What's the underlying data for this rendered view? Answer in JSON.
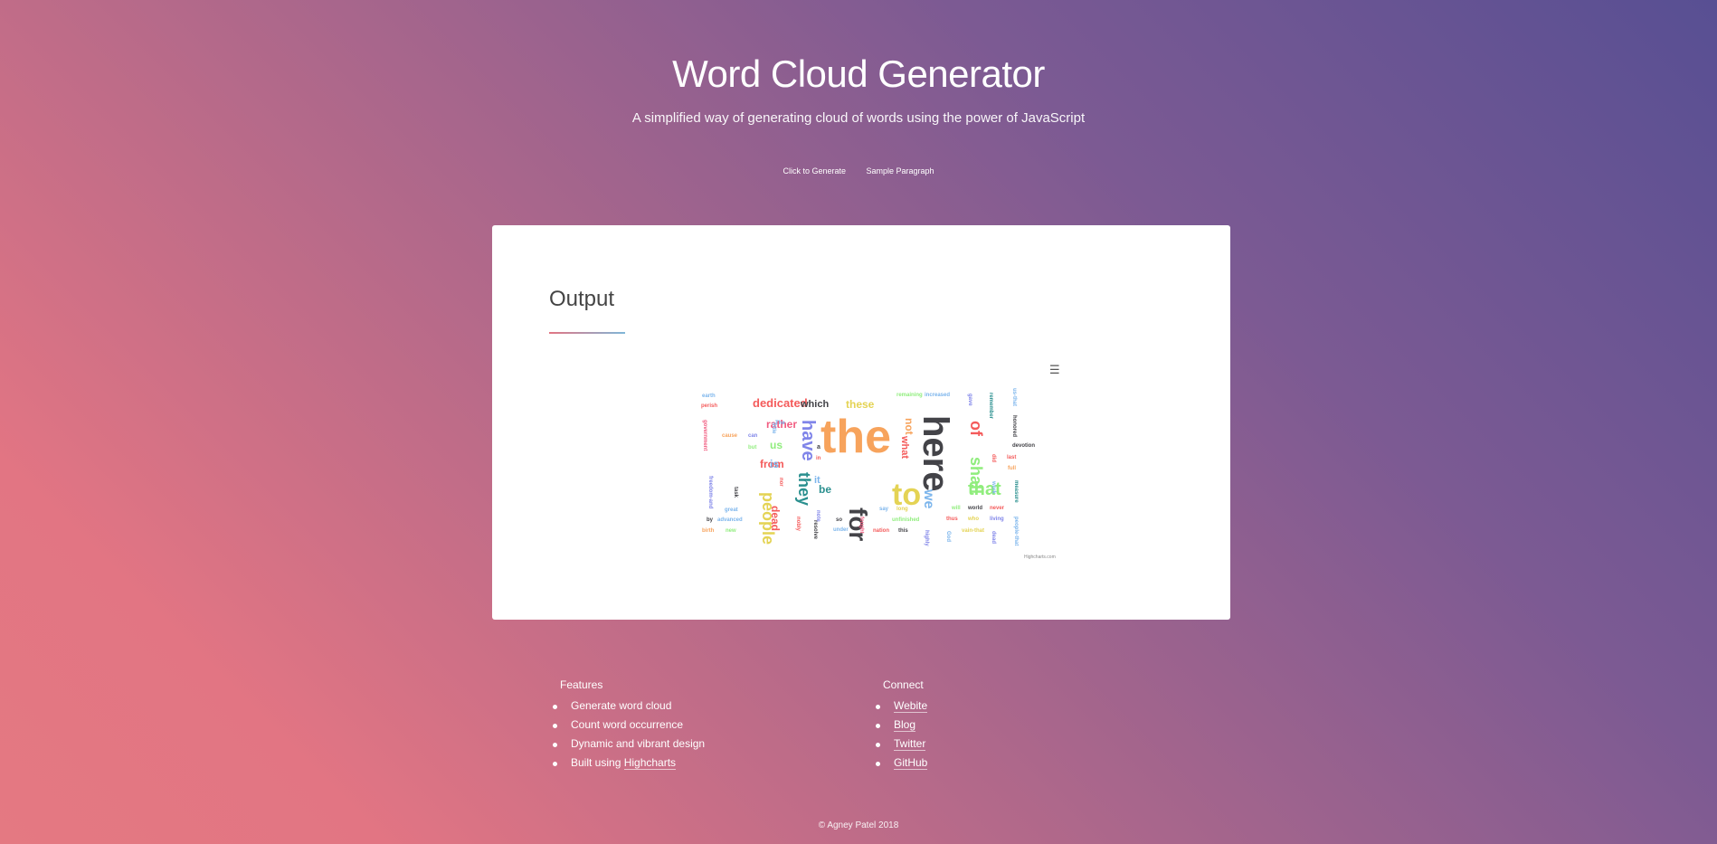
{
  "header": {
    "title": "Word Cloud Generator",
    "subtitle": "A simplified way of generating cloud of words using the power of JavaScript"
  },
  "actions": {
    "generate_label": "Click to Generate",
    "sample_label": "Sample Paragraph"
  },
  "output": {
    "heading": "Output",
    "menu_icon": "hamburger-menu-icon",
    "credit": "Highcharts.com"
  },
  "chart_data": {
    "type": "wordcloud",
    "words": [
      {
        "word": "the",
        "color": "#f7a35c"
      },
      {
        "word": "here",
        "color": "#434348"
      },
      {
        "word": "to",
        "color": "#e4d354"
      },
      {
        "word": "for",
        "color": "#434348"
      },
      {
        "word": "have",
        "color": "#8085e9"
      },
      {
        "word": "they",
        "color": "#2b908f"
      },
      {
        "word": "people",
        "color": "#e4d354"
      },
      {
        "word": "that",
        "color": "#90ed7d"
      },
      {
        "word": "shall",
        "color": "#90ed7d"
      },
      {
        "word": "we",
        "color": "#7cb5ec"
      },
      {
        "word": "of",
        "color": "#f45b5b"
      },
      {
        "word": "dedicated",
        "color": "#f45b5b"
      },
      {
        "word": "which",
        "color": "#434348"
      },
      {
        "word": "these",
        "color": "#e4d354"
      },
      {
        "word": "rather",
        "color": "#f15c80"
      },
      {
        "word": "from",
        "color": "#f45b5b"
      },
      {
        "word": "is",
        "color": "#7cb5ec"
      },
      {
        "word": "us",
        "color": "#90ed7d"
      },
      {
        "word": "not",
        "color": "#f7a35c"
      },
      {
        "word": "what",
        "color": "#f45b5b"
      },
      {
        "word": "dead",
        "color": "#f45b5b"
      },
      {
        "word": "be",
        "color": "#2b908f"
      },
      {
        "word": "it",
        "color": "#7cb5ec"
      },
      {
        "word": "a",
        "color": "#434348"
      },
      {
        "word": "in",
        "color": "#f45b5b"
      },
      {
        "word": "earth",
        "color": "#7cb5ec"
      },
      {
        "word": "perish",
        "color": "#f45b5b"
      },
      {
        "word": "government",
        "color": "#f15c80"
      },
      {
        "word": "cause",
        "color": "#f7a35c"
      },
      {
        "word": "can",
        "color": "#8085e9"
      },
      {
        "word": "but",
        "color": "#90ed7d"
      },
      {
        "word": "The",
        "color": "#7cb5ec"
      },
      {
        "word": "task",
        "color": "#434348"
      },
      {
        "word": "freedom-and",
        "color": "#8085e9"
      },
      {
        "word": "great",
        "color": "#7cb5ec"
      },
      {
        "word": "by",
        "color": "#434348"
      },
      {
        "word": "advanced",
        "color": "#7cb5ec"
      },
      {
        "word": "birth",
        "color": "#f7a35c"
      },
      {
        "word": "new",
        "color": "#90ed7d"
      },
      {
        "word": "nobly",
        "color": "#f45b5b"
      },
      {
        "word": "resolve",
        "color": "#434348"
      },
      {
        "word": "so",
        "color": "#434348"
      },
      {
        "word": "under",
        "color": "#7cb5ec"
      },
      {
        "word": "say",
        "color": "#7cb5ec"
      },
      {
        "word": "long",
        "color": "#e4d354"
      },
      {
        "word": "unfinished",
        "color": "#90ed7d"
      },
      {
        "word": "nation",
        "color": "#f45b5b"
      },
      {
        "word": "this",
        "color": "#434348"
      },
      {
        "word": "fought",
        "color": "#f15c80"
      },
      {
        "word": "remaining",
        "color": "#90ed7d"
      },
      {
        "word": "increased",
        "color": "#7cb5ec"
      },
      {
        "word": "gave",
        "color": "#8085e9"
      },
      {
        "word": "remember",
        "color": "#2b908f"
      },
      {
        "word": "us-that",
        "color": "#7cb5ec"
      },
      {
        "word": "honored",
        "color": "#434348"
      },
      {
        "word": "devotion",
        "color": "#434348"
      },
      {
        "word": "last",
        "color": "#f45b5b"
      },
      {
        "word": "full",
        "color": "#f7a35c"
      },
      {
        "word": "did",
        "color": "#f45b5b"
      },
      {
        "word": "work",
        "color": "#7cb5ec"
      },
      {
        "word": "measure",
        "color": "#2b908f"
      },
      {
        "word": "will",
        "color": "#90ed7d"
      },
      {
        "word": "world",
        "color": "#434348"
      },
      {
        "word": "never",
        "color": "#f45b5b"
      },
      {
        "word": "thus",
        "color": "#f45b5b"
      },
      {
        "word": "who",
        "color": "#e4d354"
      },
      {
        "word": "living",
        "color": "#8085e9"
      },
      {
        "word": "vain-that",
        "color": "#e4d354"
      },
      {
        "word": "God",
        "color": "#7cb5ec"
      },
      {
        "word": "dead",
        "color": "#8085e9"
      },
      {
        "word": "people-that",
        "color": "#7cb5ec"
      },
      {
        "word": "little",
        "color": "#7cb5ec"
      },
      {
        "word": "highly",
        "color": "#8085e9"
      },
      {
        "word": "note",
        "color": "#8085e9"
      },
      {
        "word": "nor",
        "color": "#f45b5b"
      }
    ]
  },
  "footer": {
    "features_title": "Features",
    "features": [
      {
        "text": "Generate word cloud"
      },
      {
        "text": "Count word occurrence"
      },
      {
        "text": "Dynamic and vibrant design"
      },
      {
        "text": "Built using ",
        "link": "Highcharts"
      }
    ],
    "connect_title": "Connect",
    "connect": [
      "Webite",
      "Blog",
      "Twitter",
      "GitHub"
    ],
    "copyright": "© Agney Patel 2018"
  }
}
